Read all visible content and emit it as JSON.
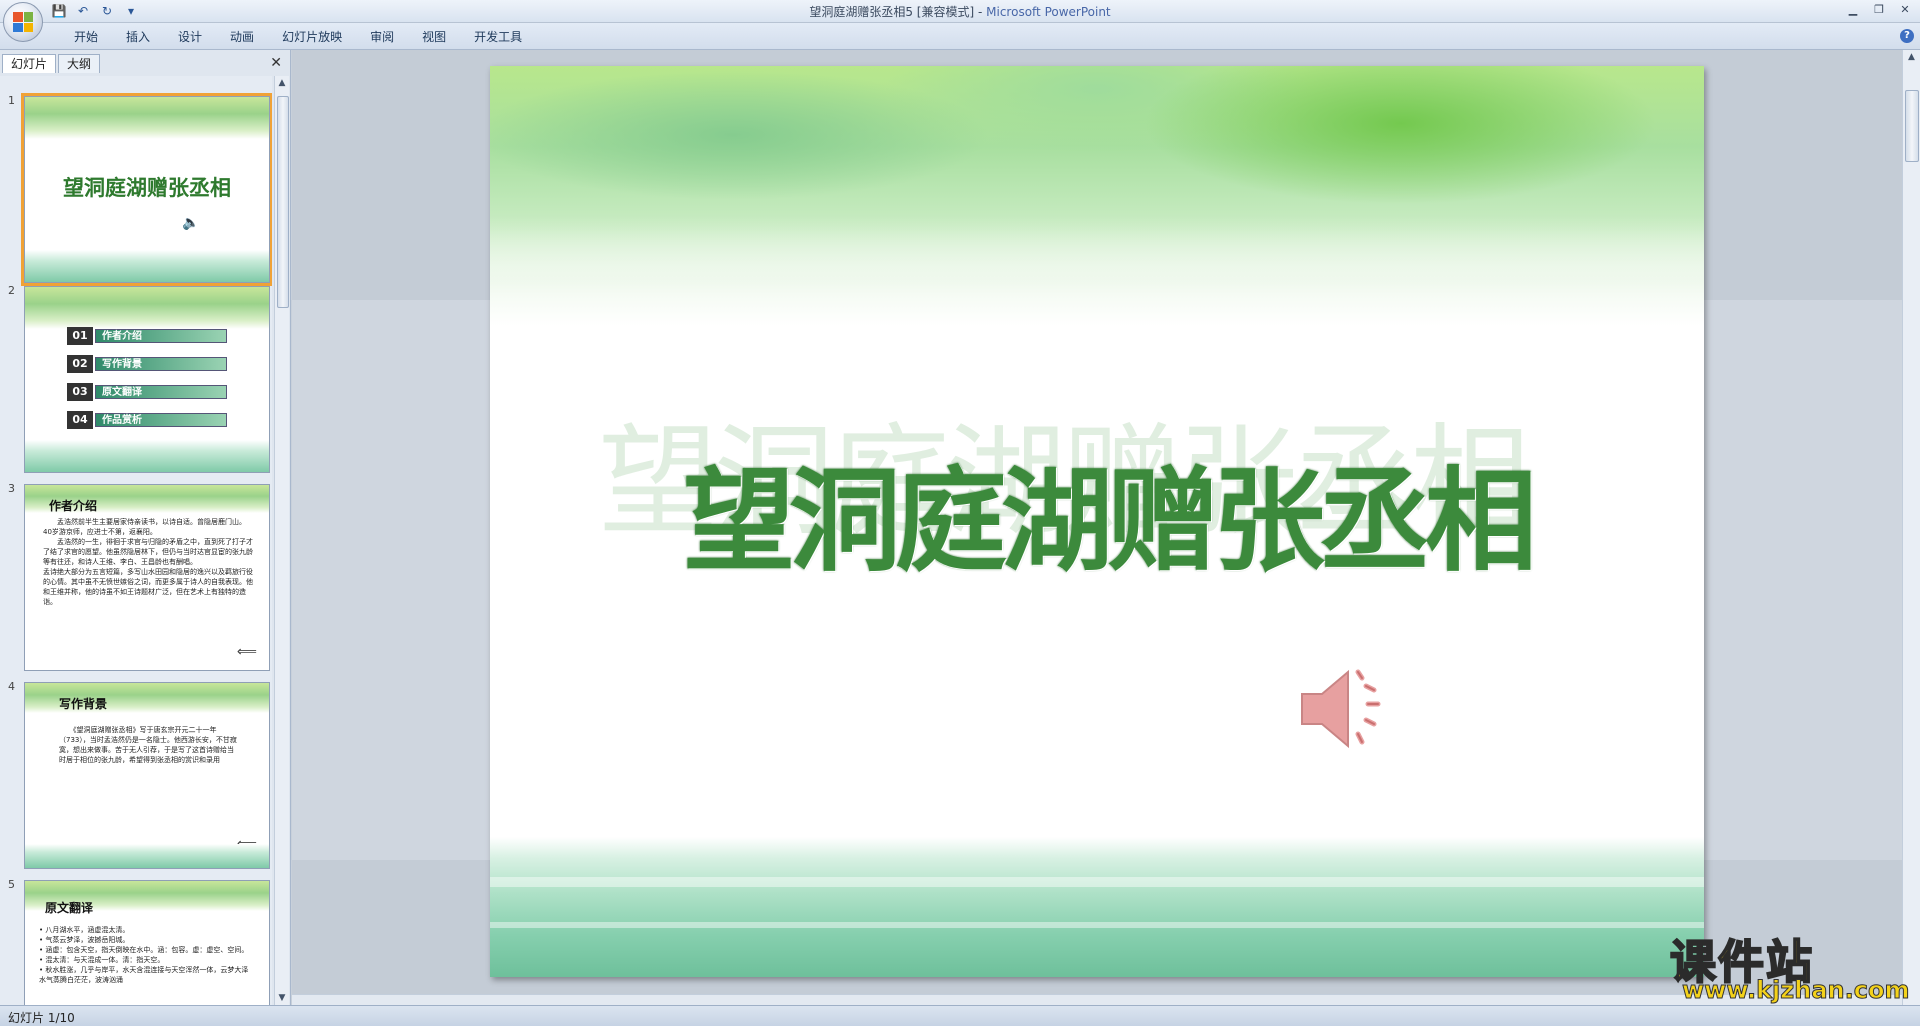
{
  "window": {
    "doc_title": "望洞庭湖赠张丞相5 [兼容模式]",
    "separator": " - ",
    "app_name": "Microsoft PowerPoint"
  },
  "qat": {
    "save_icon": "save-icon",
    "undo_icon": "undo-icon",
    "redo_icon": "redo-icon",
    "more_icon": "chevron-down-icon"
  },
  "ribbon": {
    "tabs": [
      "开始",
      "插入",
      "设计",
      "动画",
      "幻灯片放映",
      "审阅",
      "视图",
      "开发工具"
    ],
    "help": "?"
  },
  "left_pane": {
    "tabs": [
      "幻灯片",
      "大纲"
    ],
    "close": "✕"
  },
  "thumbnails": [
    {
      "num": "1",
      "title": "望洞庭湖赠张丞相"
    },
    {
      "num": "2",
      "items": [
        {
          "n": "01",
          "label": "作者介绍"
        },
        {
          "n": "02",
          "label": "写作背景"
        },
        {
          "n": "03",
          "label": "原文翻译"
        },
        {
          "n": "04",
          "label": "作品赏析"
        }
      ]
    },
    {
      "num": "3",
      "heading": "作者介绍",
      "body": "　　孟浩然前半生主要居家侍亲读书，以诗自适。曾隐居鹿门山。40岁游京师，应进士不第，返襄阳。\n　　孟浩然的一生，徘徊于求官与归隐的矛盾之中，直到死了打子才了结了求官的愿望。他虽然隐居林下，但仍与当时达官显宦的张九龄等有往还，和诗人王维、李白、王昌龄也有酬唱。\n孟诗绝大部分为五言短篇，多写山水田园和隐居的逸兴以及羁旅行役的心情。其中虽不无愤世嫉俗之词，而更多属于诗人的自我表现。他和王维并称，他的诗虽不如王诗题材广泛，但在艺术上有独特的造诣。"
    },
    {
      "num": "4",
      "heading": "写作背景",
      "body": "　　《望洞庭湖赠张丞相》写于唐玄宗开元二十一年（733），当时孟浩然仍是一名隐士。他西游长安，不甘寂寞，想出来做事。苦于无人引荐，于是写了这首诗赠给当时居于相位的张九龄，希望得到张丞相的赏识和录用"
    },
    {
      "num": "5",
      "heading": "原文翻译",
      "body": "• 八月湖水平，涵虚混太清。\n• 气蒸云梦泽，波撼岳阳城。\n• 涵虚：包含天空，指天倒映在水中。涵：包容。虚：虚空、空间。\n• 混太清：与天混成一体。清：指天空。\n• 秋水胜涨，几乎与岸平，水天含混连接与天空浑然一体，云梦大泽水气蒸腾白茫茫，波涛汹涌"
    }
  ],
  "slide": {
    "title": "望洞庭湖赠张丞相",
    "speaker_icon": "speaker-icon"
  },
  "status": {
    "text": "幻灯片 1/10"
  },
  "watermark": {
    "main": "课件站",
    "sub": "www.kjzhan.com"
  }
}
